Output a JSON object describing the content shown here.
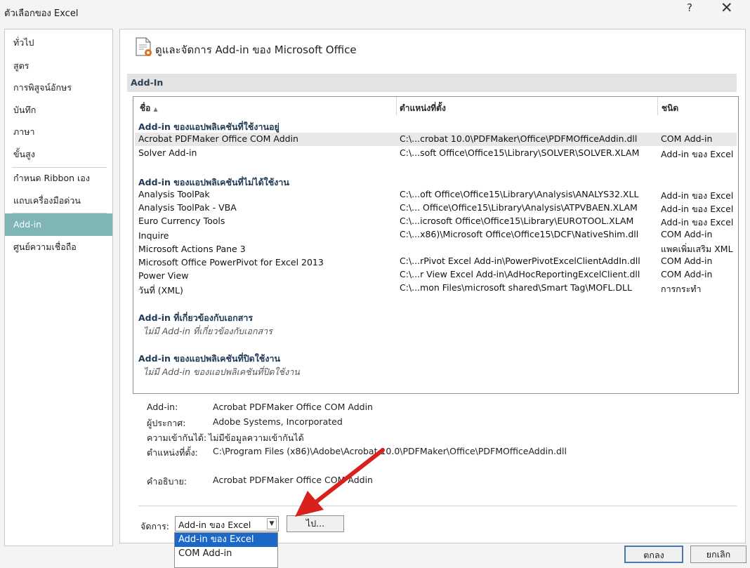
{
  "window": {
    "title": "ตัวเลือกของ Excel",
    "help_label": "?",
    "close_label": "✕"
  },
  "nav": {
    "items": [
      {
        "label": "ทั่วไป",
        "active": false
      },
      {
        "label": "สูตร",
        "active": false
      },
      {
        "label": "การพิสูจน์อักษร",
        "active": false
      },
      {
        "label": "บันทึก",
        "active": false
      },
      {
        "label": "ภาษา",
        "active": false
      },
      {
        "label": "ขั้นสูง",
        "active": false
      },
      {
        "label": "กำหนด Ribbon เอง",
        "active": false
      },
      {
        "label": "แถบเครื่องมือด่วน",
        "active": false
      },
      {
        "label": "Add-in",
        "active": true
      },
      {
        "label": "ศูนย์ความเชื่อถือ",
        "active": false
      }
    ]
  },
  "main": {
    "header_title": "ดูและจัดการ  Add-in ของ Microsoft Office",
    "section_title": "Add-In",
    "columns": {
      "name": "ชื่อ",
      "location": "ตำแหน่งที่ตั้ง",
      "type": "ชนิด",
      "sort_indicator": "▲"
    },
    "groups": {
      "active": "Add-in ของแอปพลิเคชันที่ใช้งานอยู่",
      "inactive": "Add-in ของแอปพลิเคชันที่ไม่ได้ใช้งาน",
      "document": "Add-in ที่เกี่ยวข้องกับเอกสาร",
      "document_empty": "ไม่มี Add-in ที่เกี่ยวข้องกับเอกสาร",
      "disabled": "Add-in ของแอปพลิเคชันที่ปิดใช้งาน",
      "disabled_empty": "ไม่มี Add-in ของแอปพลิเคชันที่ปิดใช้งาน"
    },
    "active_rows": [
      {
        "name": "Acrobat PDFMaker Office COM Addin",
        "location": "C:\\...crobat 10.0\\PDFMaker\\Office\\PDFMOfficeAddin.dll",
        "type": "COM Add-in",
        "selected": true
      },
      {
        "name": "Solver Add-in",
        "location": "C:\\...soft Office\\Office15\\Library\\SOLVER\\SOLVER.XLAM",
        "type": "Add-in ของ Excel",
        "selected": false
      }
    ],
    "inactive_rows": [
      {
        "name": "Analysis ToolPak",
        "location": "C:\\...oft Office\\Office15\\Library\\Analysis\\ANALYS32.XLL",
        "type": "Add-in ของ Excel"
      },
      {
        "name": "Analysis ToolPak - VBA",
        "location": "C:\\... Office\\Office15\\Library\\Analysis\\ATPVBAEN.XLAM",
        "type": "Add-in ของ Excel"
      },
      {
        "name": "Euro Currency Tools",
        "location": "C:\\...icrosoft Office\\Office15\\Library\\EUROTOOL.XLAM",
        "type": "Add-in ของ Excel"
      },
      {
        "name": "Inquire",
        "location": "C:\\...x86)\\Microsoft Office\\Office15\\DCF\\NativeShim.dll",
        "type": "COM Add-in"
      },
      {
        "name": "Microsoft Actions Pane 3",
        "location": "",
        "type": "แพคเพิ่มเสริม XML"
      },
      {
        "name": "Microsoft Office PowerPivot for Excel 2013",
        "location": "C:\\...rPivot Excel Add-in\\PowerPivotExcelClientAddIn.dll",
        "type": "COM Add-in"
      },
      {
        "name": "Power View",
        "location": "C:\\...r View Excel Add-in\\AdHocReportingExcelClient.dll",
        "type": "COM Add-in"
      },
      {
        "name": "วันที่ (XML)",
        "location": "C:\\...mon Files\\microsoft shared\\Smart Tag\\MOFL.DLL",
        "type": "การกระทำ"
      }
    ],
    "details": {
      "addin_label": "Add-in:",
      "addin_value": "Acrobat PDFMaker Office COM Addin",
      "publisher_label": "ผู้ประกาศ:",
      "publisher_value": "Adobe Systems, Incorporated",
      "compat_label": "ความเข้ากันได้:",
      "compat_value": "ไม่มีข้อมูลความเข้ากันได้",
      "location_label": "ตำแหน่งที่ตั้ง:",
      "location_value": "C:\\Program Files (x86)\\Adobe\\Acrobat 10.0\\PDFMaker\\Office\\PDFMOfficeAddin.dll",
      "description_label": "คำอธิบาย:",
      "description_value": "Acrobat PDFMaker Office COM Addin"
    },
    "manage": {
      "label": "จัดการ:",
      "selected": "Add-in ของ Excel",
      "go_label": "ไป..."
    }
  },
  "dropdown": {
    "options": [
      {
        "label": "Add-in ของ Excel",
        "selected": true
      },
      {
        "label": "COM Add-in",
        "selected": false
      }
    ]
  },
  "footer": {
    "ok_label": "ตกลง",
    "cancel_label": "ยกเลิก"
  },
  "colors": {
    "nav_active_bg": "#7fb5b5",
    "arrow": "#d8201c",
    "dropdown_highlight": "#1c68c7"
  }
}
